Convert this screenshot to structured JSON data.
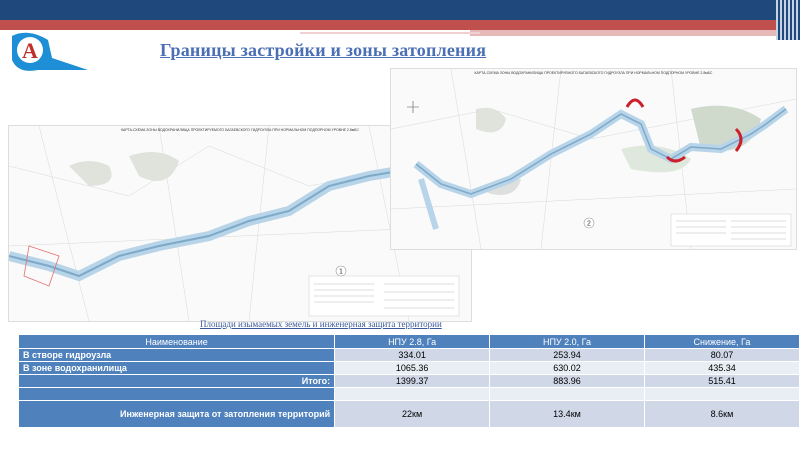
{
  "header": {
    "title": "Границы застройки и зоны затопления"
  },
  "logo": {
    "letter": "А"
  },
  "maps": [
    {
      "title": "КАРТА-СХЕМА ЗОНЫ ВОДОХРАНИЛИЩА ПРОЕКТИРУЕМОГО БАГАЕВСКОГО ГИДРОУЗЛА ПРИ НОРМАЛЬНОМ ПОДПОРНОМ УРОВНЕ 2.8мБС",
      "number": "1"
    },
    {
      "title": "КАРТА-СХЕМА ЗОНЫ ВОДОХРАНИЛИЩА ПРОЕКТИРУЕМОГО БАГАЕВСКОГО ГИДРОУЗЛА ПРИ НОРМАЛЬНОМ ПОДПОРНОМ УРОВНЕ 2.8мБС",
      "number": "2"
    }
  ],
  "table": {
    "caption": "Площади изымаемых земель и инженерная защита территории",
    "headers": [
      "Наименование",
      "НПУ 2.8, Га",
      "НПУ 2.0, Га",
      "Снижение, Га"
    ],
    "rows": [
      {
        "label": "В створе гидроузла",
        "values": [
          "334.01",
          "253.94",
          "80.07"
        ]
      },
      {
        "label": "В зоне водохранилища",
        "values": [
          "1065.36",
          "630.02",
          "435.34"
        ]
      },
      {
        "label": "Итого:",
        "values": [
          "1399.37",
          "883.96",
          "515.41"
        ]
      },
      {
        "label": "",
        "values": [
          "",
          "",
          ""
        ]
      },
      {
        "label": "Инженерная защита от затопления территорий",
        "values": [
          "22км",
          "13.4км",
          "8.6км"
        ]
      }
    ]
  }
}
